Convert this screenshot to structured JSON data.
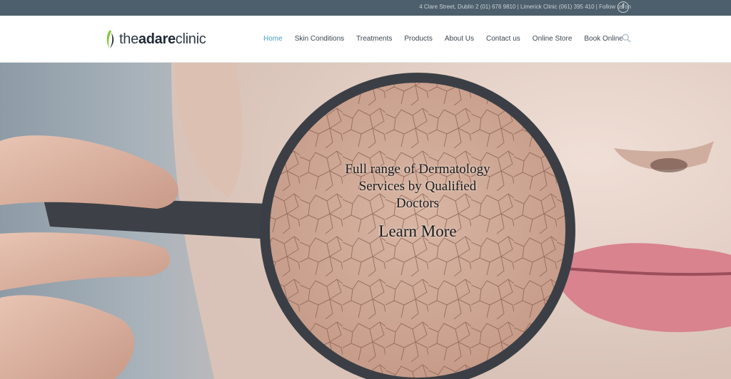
{
  "topbar": {
    "info": "4 Clare Street, Dublin 2 (01) 676 9810 | Limerick Clinic (061) 395 410 | Follow us on",
    "social_icon": "facebook-icon"
  },
  "header": {
    "logo": {
      "prefix": "the",
      "bold": "adare",
      "suffix": "clinic"
    },
    "nav": [
      {
        "label": "Home",
        "active": true
      },
      {
        "label": "Skin Conditions"
      },
      {
        "label": "Treatments"
      },
      {
        "label": "Products"
      },
      {
        "label": "About Us"
      },
      {
        "label": "Contact us"
      },
      {
        "label": "Online Store"
      },
      {
        "label": "Book Online"
      }
    ],
    "search_icon": "search-icon"
  },
  "hero": {
    "heading_line1": "Full range of Dermatology",
    "heading_line2": "Services by Qualified",
    "heading_line3": "Doctors",
    "cta": "Learn More"
  },
  "colors": {
    "topbar_bg": "#4d5f6c",
    "nav_active": "#4aa0c9",
    "nav_text": "#3b4650",
    "lips": "#d8838e"
  }
}
